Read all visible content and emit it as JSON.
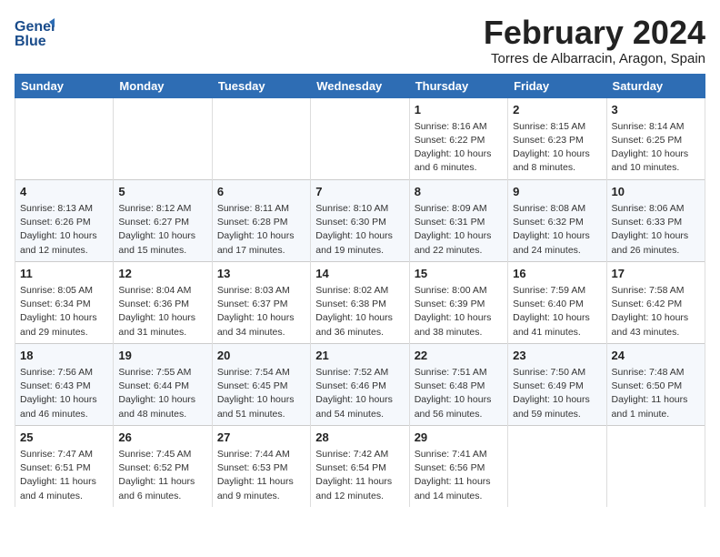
{
  "header": {
    "logo_line1": "General",
    "logo_line2": "Blue",
    "month": "February 2024",
    "location": "Torres de Albarracin, Aragon, Spain"
  },
  "weekdays": [
    "Sunday",
    "Monday",
    "Tuesday",
    "Wednesday",
    "Thursday",
    "Friday",
    "Saturday"
  ],
  "rows": [
    [
      {
        "day": "",
        "content": ""
      },
      {
        "day": "",
        "content": ""
      },
      {
        "day": "",
        "content": ""
      },
      {
        "day": "",
        "content": ""
      },
      {
        "day": "1",
        "content": "Sunrise: 8:16 AM\nSunset: 6:22 PM\nDaylight: 10 hours\nand 6 minutes."
      },
      {
        "day": "2",
        "content": "Sunrise: 8:15 AM\nSunset: 6:23 PM\nDaylight: 10 hours\nand 8 minutes."
      },
      {
        "day": "3",
        "content": "Sunrise: 8:14 AM\nSunset: 6:25 PM\nDaylight: 10 hours\nand 10 minutes."
      }
    ],
    [
      {
        "day": "4",
        "content": "Sunrise: 8:13 AM\nSunset: 6:26 PM\nDaylight: 10 hours\nand 12 minutes."
      },
      {
        "day": "5",
        "content": "Sunrise: 8:12 AM\nSunset: 6:27 PM\nDaylight: 10 hours\nand 15 minutes."
      },
      {
        "day": "6",
        "content": "Sunrise: 8:11 AM\nSunset: 6:28 PM\nDaylight: 10 hours\nand 17 minutes."
      },
      {
        "day": "7",
        "content": "Sunrise: 8:10 AM\nSunset: 6:30 PM\nDaylight: 10 hours\nand 19 minutes."
      },
      {
        "day": "8",
        "content": "Sunrise: 8:09 AM\nSunset: 6:31 PM\nDaylight: 10 hours\nand 22 minutes."
      },
      {
        "day": "9",
        "content": "Sunrise: 8:08 AM\nSunset: 6:32 PM\nDaylight: 10 hours\nand 24 minutes."
      },
      {
        "day": "10",
        "content": "Sunrise: 8:06 AM\nSunset: 6:33 PM\nDaylight: 10 hours\nand 26 minutes."
      }
    ],
    [
      {
        "day": "11",
        "content": "Sunrise: 8:05 AM\nSunset: 6:34 PM\nDaylight: 10 hours\nand 29 minutes."
      },
      {
        "day": "12",
        "content": "Sunrise: 8:04 AM\nSunset: 6:36 PM\nDaylight: 10 hours\nand 31 minutes."
      },
      {
        "day": "13",
        "content": "Sunrise: 8:03 AM\nSunset: 6:37 PM\nDaylight: 10 hours\nand 34 minutes."
      },
      {
        "day": "14",
        "content": "Sunrise: 8:02 AM\nSunset: 6:38 PM\nDaylight: 10 hours\nand 36 minutes."
      },
      {
        "day": "15",
        "content": "Sunrise: 8:00 AM\nSunset: 6:39 PM\nDaylight: 10 hours\nand 38 minutes."
      },
      {
        "day": "16",
        "content": "Sunrise: 7:59 AM\nSunset: 6:40 PM\nDaylight: 10 hours\nand 41 minutes."
      },
      {
        "day": "17",
        "content": "Sunrise: 7:58 AM\nSunset: 6:42 PM\nDaylight: 10 hours\nand 43 minutes."
      }
    ],
    [
      {
        "day": "18",
        "content": "Sunrise: 7:56 AM\nSunset: 6:43 PM\nDaylight: 10 hours\nand 46 minutes."
      },
      {
        "day": "19",
        "content": "Sunrise: 7:55 AM\nSunset: 6:44 PM\nDaylight: 10 hours\nand 48 minutes."
      },
      {
        "day": "20",
        "content": "Sunrise: 7:54 AM\nSunset: 6:45 PM\nDaylight: 10 hours\nand 51 minutes."
      },
      {
        "day": "21",
        "content": "Sunrise: 7:52 AM\nSunset: 6:46 PM\nDaylight: 10 hours\nand 54 minutes."
      },
      {
        "day": "22",
        "content": "Sunrise: 7:51 AM\nSunset: 6:48 PM\nDaylight: 10 hours\nand 56 minutes."
      },
      {
        "day": "23",
        "content": "Sunrise: 7:50 AM\nSunset: 6:49 PM\nDaylight: 10 hours\nand 59 minutes."
      },
      {
        "day": "24",
        "content": "Sunrise: 7:48 AM\nSunset: 6:50 PM\nDaylight: 11 hours\nand 1 minute."
      }
    ],
    [
      {
        "day": "25",
        "content": "Sunrise: 7:47 AM\nSunset: 6:51 PM\nDaylight: 11 hours\nand 4 minutes."
      },
      {
        "day": "26",
        "content": "Sunrise: 7:45 AM\nSunset: 6:52 PM\nDaylight: 11 hours\nand 6 minutes."
      },
      {
        "day": "27",
        "content": "Sunrise: 7:44 AM\nSunset: 6:53 PM\nDaylight: 11 hours\nand 9 minutes."
      },
      {
        "day": "28",
        "content": "Sunrise: 7:42 AM\nSunset: 6:54 PM\nDaylight: 11 hours\nand 12 minutes."
      },
      {
        "day": "29",
        "content": "Sunrise: 7:41 AM\nSunset: 6:56 PM\nDaylight: 11 hours\nand 14 minutes."
      },
      {
        "day": "",
        "content": ""
      },
      {
        "day": "",
        "content": ""
      }
    ]
  ]
}
